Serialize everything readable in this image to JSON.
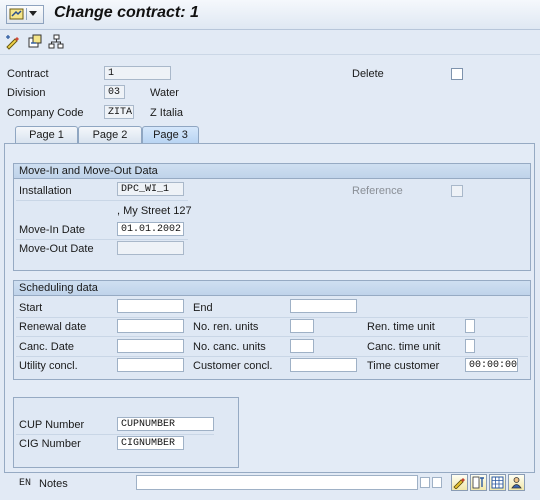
{
  "window": {
    "title": "Change contract:  1"
  },
  "header": {
    "contract_label": "Contract",
    "contract_value": "1",
    "delete_label": "Delete",
    "division_label": "Division",
    "division_value": "03",
    "division_text": "Water",
    "company_label": "Company Code",
    "company_value": "ZITA",
    "company_text": "Z Italia"
  },
  "tabs": [
    {
      "label": "Page 1"
    },
    {
      "label": "Page 2"
    },
    {
      "label": "Page 3"
    }
  ],
  "active_tab": "Page 3",
  "movein": {
    "title": "Move-In and Move-Out Data",
    "installation_label": "Installation",
    "installation_value": "DPC_WI_1",
    "reference_label": "Reference",
    "address": ", My Street 127",
    "movein_label": "Move-In Date",
    "movein_value": "01.01.2002",
    "moveout_label": "Move-Out Date",
    "moveout_value": ""
  },
  "scheduling": {
    "title": "Scheduling data",
    "start_label": "Start",
    "end_label": "End",
    "renewal_label": "Renewal date",
    "ren_units_label": "No. ren. units",
    "ren_time_label": "Ren. time unit",
    "canc_label": "Canc. Date",
    "canc_units_label": "No. canc. units",
    "canc_time_label": "Canc. time unit",
    "utility_label": "Utility concl.",
    "customer_concl_label": "Customer concl.",
    "time_customer_label": "Time customer",
    "time_customer_value": "00:00:00"
  },
  "codes": {
    "cup_label": "CUP Number",
    "cup_value": "CUPNUMBER",
    "cig_label": "CIG Number",
    "cig_value": "CIGNUMBER"
  },
  "notes": {
    "lang": "EN",
    "label": "Notes",
    "value": ""
  },
  "icons": [
    "menu-icon",
    "display-change-icon",
    "object-services-icon",
    "hierarchy-icon",
    "edit-notes-icon",
    "text-icon",
    "table-icon",
    "person-icon"
  ]
}
